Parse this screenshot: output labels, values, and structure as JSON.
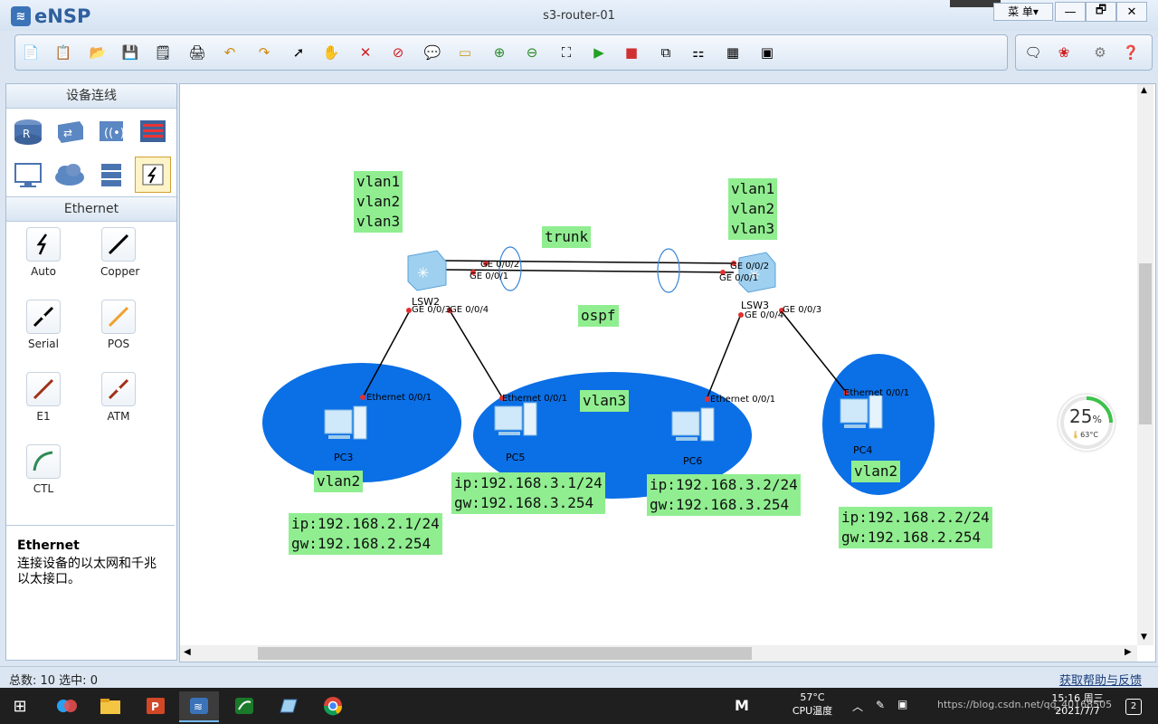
{
  "window": {
    "app_name": "eNSP",
    "title": "s3-router-01",
    "menu_label": "菜 单▾",
    "buttons": {
      "minimize": "—",
      "restore": "🗗",
      "close": "✕"
    }
  },
  "toolbar": {
    "icons": [
      "new-topology",
      "new-example",
      "open",
      "save",
      "save-as",
      "print",
      "undo",
      "redo",
      "select",
      "pan",
      "delete",
      "delete-all-links",
      "text",
      "palette",
      "zoom-in",
      "zoom-out",
      "fit",
      "start",
      "stop",
      "capture",
      "topology-grid",
      "table",
      "terminal"
    ],
    "right_icons": [
      "chat",
      "huawei-logo",
      "settings",
      "help"
    ]
  },
  "left_panel": {
    "title": "设备连线",
    "device_icons": [
      "router-icon",
      "switch-icon",
      "wireless-icon",
      "firewall-icon",
      "pc-icon",
      "cloud-icon",
      "server-icon",
      "cable-icon"
    ],
    "section_title": "Ethernet",
    "cables": [
      {
        "name": "Auto",
        "icon": "auto-cable-icon",
        "color": "#000000"
      },
      {
        "name": "Copper",
        "icon": "copper-cable-icon",
        "color": "#000000"
      },
      {
        "name": "Serial",
        "icon": "serial-cable-icon",
        "color": "#000000"
      },
      {
        "name": "POS",
        "icon": "pos-cable-icon",
        "color": "#f0a030"
      },
      {
        "name": "E1",
        "icon": "e1-cable-icon",
        "color": "#a0301a"
      },
      {
        "name": "ATM",
        "icon": "atm-cable-icon",
        "color": "#a0301a"
      },
      {
        "name": "CTL",
        "icon": "ctl-cable-icon",
        "color": "#2e8b57"
      }
    ],
    "desc_title": "Ethernet",
    "desc_text": "连接设备的以太网和千兆以太接口。"
  },
  "topology": {
    "labels": {
      "lsw2_vlans": "vlan1\nvlan2\nvlan3",
      "lsw3_vlans": "vlan1\nvlan2\nvlan3",
      "trunk": "trunk",
      "ospf": "ospf",
      "vlan3": "vlan3",
      "pc3_vlan": "vlan2",
      "pc4_vlan": "vlan2",
      "pc3_ip": "ip:192.168.2.1/24\ngw:192.168.2.254",
      "pc5_ip": "ip:192.168.3.1/24\ngw:192.168.3.254",
      "pc6_ip": "ip:192.168.3.2/24\ngw:192.168.3.254",
      "pc4_ip": "ip:192.168.2.2/24\ngw:192.168.2.254"
    },
    "devices": {
      "lsw2": "LSW2",
      "lsw3": "LSW3",
      "pc3": "PC3",
      "pc5": "PC5",
      "pc6": "PC6",
      "pc4": "PC4"
    },
    "ports": {
      "lsw2_ge002": "GE 0/0/2",
      "lsw2_ge001": "GE 0/0/1",
      "lsw2_ge003": "GE 0/0/3",
      "lsw2_ge004": "GE 0/0/4",
      "lsw3_ge002": "GE 0/0/2",
      "lsw3_ge001": "GE 0/0/1",
      "lsw3_ge004": "GE 0/0/4",
      "lsw3_ge003": "GE 0/0/3",
      "pc3_eth": "Ethernet 0/0/1",
      "pc5_eth": "Ethernet 0/0/1",
      "pc6_eth": "Ethernet 0/0/1",
      "pc4_eth": "Ethernet 0/0/1"
    },
    "colors": {
      "vlan_area": "#0b6fe6",
      "label_bg": "#90ee90",
      "port_dot": "#e03030"
    }
  },
  "cpu_widget": {
    "usage": "25",
    "unit": "%",
    "temp": "63°C"
  },
  "status_bar": {
    "total_label": "总数: 10 选中: 0",
    "help_link": "获取帮助与反馈"
  },
  "taskbar": {
    "apps": [
      "windows-start",
      "baidu-netdisk",
      "file-explorer",
      "powerpoint",
      "ensp",
      "wireshark",
      "virtualbox",
      "chrome"
    ],
    "tray": {
      "cpu_temp": "57°C",
      "cpu_label": "CPU温度",
      "time": "15:16 周三",
      "date": "2021/7/7",
      "watermark": "https://blog.csdn.net/qq_40168505",
      "notification_count": "2"
    }
  }
}
